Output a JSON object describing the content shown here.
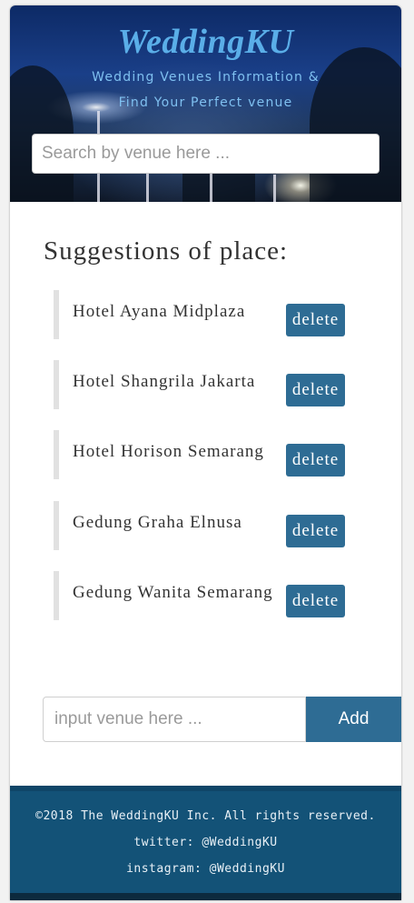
{
  "header": {
    "brand": "WeddingKU",
    "tagline_line1": "Wedding Venues Information &",
    "tagline_line2": "Find Your Perfect venue",
    "search_placeholder": "Search by venue here ..."
  },
  "suggestions": {
    "heading": "Suggestions of place:",
    "items": [
      {
        "name": "Hotel Ayana Midplaza",
        "delete_label": "delete"
      },
      {
        "name": "Hotel Shangrila Jakarta",
        "delete_label": "delete"
      },
      {
        "name": "Hotel Horison Semarang",
        "delete_label": "delete"
      },
      {
        "name": "Gedung Graha Elnusa",
        "delete_label": "delete"
      },
      {
        "name": "Gedung Wanita Semarang",
        "delete_label": "delete"
      }
    ]
  },
  "add_form": {
    "placeholder": "input venue here ...",
    "button_label": "Add"
  },
  "footer": {
    "copyright": "©2018 The WeddingKU Inc. All rights reserved.",
    "twitter": "twitter: @WeddingKU",
    "instagram": "instagram: @WeddingKU"
  },
  "colors": {
    "accent": "#2e6c94",
    "footer": "#135277",
    "brand": "#5aaee8"
  }
}
